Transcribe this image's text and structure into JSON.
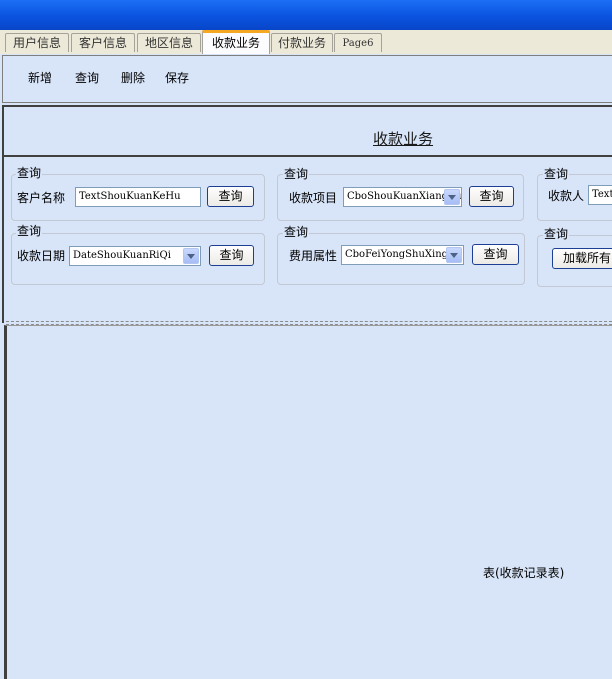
{
  "tabs": [
    {
      "label": "用户信息",
      "active": false
    },
    {
      "label": "客户信息",
      "active": false
    },
    {
      "label": "地区信息",
      "active": false
    },
    {
      "label": "收款业务",
      "active": true
    },
    {
      "label": "付款业务",
      "active": false
    },
    {
      "label": "Page6",
      "active": false
    }
  ],
  "toolbar": {
    "add_label": "新增",
    "query_label": "查询",
    "delete_label": "删除",
    "save_label": "保存"
  },
  "page_title": "收款业务",
  "filters": {
    "customer": {
      "group_label": "查询",
      "field_label": "客户名称",
      "value": "TextShouKuanKeHu",
      "button_label": "查询"
    },
    "item": {
      "group_label": "查询",
      "field_label": "收款项目",
      "value": "CboShouKuanXiangMu",
      "button_label": "查询"
    },
    "payee": {
      "group_label": "查询",
      "field_label": "收款人",
      "value": "TextShouKuanRen"
    },
    "date": {
      "group_label": "查询",
      "field_label": "收款日期",
      "value": "DateShouKuanRiQi",
      "button_label": "查询"
    },
    "fee": {
      "group_label": "查询",
      "field_label": "费用属性",
      "value": "CboFeiYongShuXing",
      "button_label": "查询"
    },
    "loadall": {
      "group_label": "查询",
      "button_label": "加载所有"
    }
  },
  "table_caption": "表(收款记录表)",
  "colors": {
    "title_bar": "#0a53e0",
    "panel_bg": "#d8e4f8",
    "active_tab_accent": "#f5a623"
  }
}
